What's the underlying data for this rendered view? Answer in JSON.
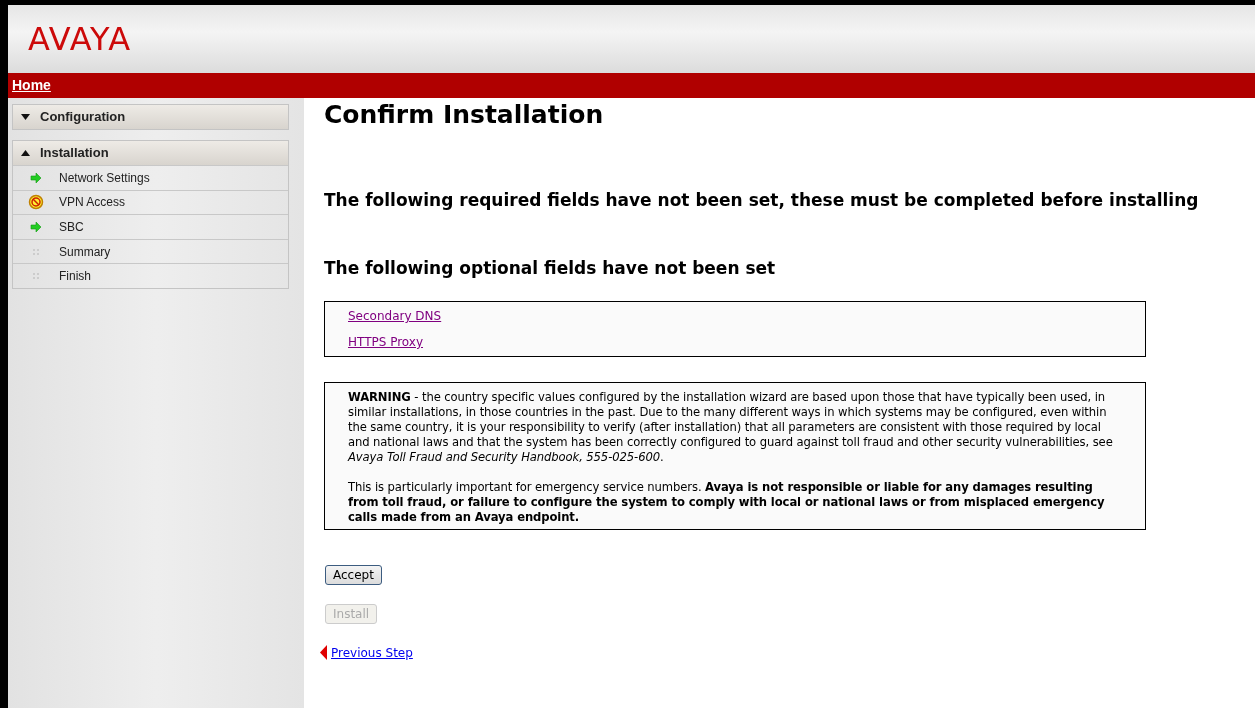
{
  "header": {
    "logo": "AVAYA"
  },
  "nav_bar": {
    "link": "Home"
  },
  "sidebar": {
    "sections": [
      {
        "label": "Configuration",
        "expanded": false
      },
      {
        "label": "Installation",
        "expanded": true,
        "items": [
          {
            "label": "Network Settings",
            "kind": "done"
          },
          {
            "label": "VPN Access",
            "kind": "blocked"
          },
          {
            "label": "SBC",
            "kind": "done"
          },
          {
            "label": "Summary",
            "kind": "pending"
          },
          {
            "label": "Finish",
            "kind": "pending"
          }
        ]
      }
    ]
  },
  "main": {
    "title": "Confirm Installation",
    "required_heading": "The following required fields have not been set, these must be completed before installing",
    "optional_heading": "The following optional fields have not been set",
    "optional_links": [
      "Secondary DNS",
      "HTTPS Proxy"
    ],
    "warning": [
      "**WARNING** - the country specific values configured by the installation wizard are based upon those that have typically been used, in similar installations, in those countries in the past. Due to the many different ways in which systems may be configured, even within the same country, it is your responsibility to verify (after installation) that all parameters are consistent with those required by local and national laws and that the system has been correctly configured to guard against toll fraud and other security vulnerabilities, see *Avaya Toll Fraud and Security Handbook, 555-025-600*.",
      "This is particularly important for emergency service numbers. **Avaya is not responsible or liable for any damages resulting from toll fraud, or failure to configure the system to comply with local or national laws or from misplaced emergency calls made from an Avaya endpoint.**"
    ],
    "buttons": [
      {
        "label": "Accept",
        "disabled": false
      },
      {
        "label": "Install",
        "disabled": true
      }
    ],
    "previous_link": "Previous Step"
  }
}
